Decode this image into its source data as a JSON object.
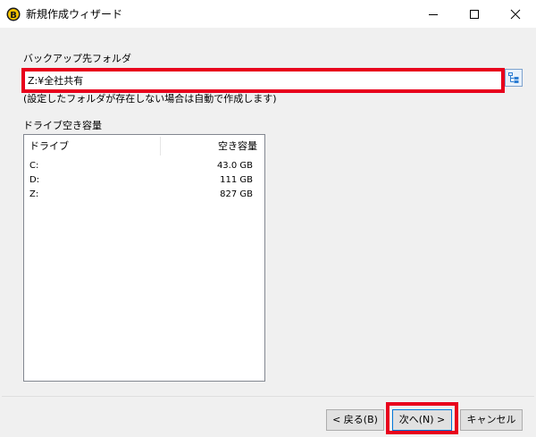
{
  "window": {
    "title": "新規作成ウィザード"
  },
  "titlebar_controls": [
    "minimize-icon",
    "maximize-icon",
    "close-icon"
  ],
  "backup": {
    "label": "バックアップ先フォルダ",
    "value": "Z:¥全社共有",
    "note": "(設定したフォルダが存在しない場合は自動で作成します)",
    "browse_icon": "folder-tree-icon"
  },
  "drives": {
    "label": "ドライブ空き容量",
    "columns": [
      "ドライブ",
      "空き容量"
    ],
    "rows": [
      {
        "drive": "C:",
        "free": "43.0 GB"
      },
      {
        "drive": "D:",
        "free": "111 GB"
      },
      {
        "drive": "Z:",
        "free": "827 GB"
      }
    ]
  },
  "buttons": {
    "back": "< 戻る(B)",
    "next": "次へ(N) >",
    "cancel": "キャンセル"
  },
  "colors": {
    "highlight": "#e8001c",
    "focus": "#0078d7",
    "icon_blue": "#2d7dd2"
  }
}
